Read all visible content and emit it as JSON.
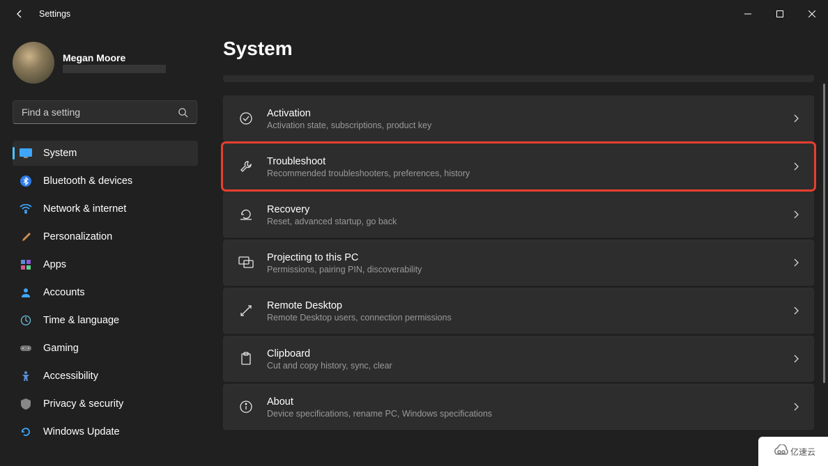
{
  "window": {
    "title": "Settings"
  },
  "user": {
    "name": "Megan Moore"
  },
  "search": {
    "placeholder": "Find a setting"
  },
  "sidebar": {
    "items": [
      {
        "label": "System",
        "icon": "💻",
        "active": true
      },
      {
        "label": "Bluetooth & devices",
        "icon": "bt"
      },
      {
        "label": "Network & internet",
        "icon": "wifi"
      },
      {
        "label": "Personalization",
        "icon": "brush"
      },
      {
        "label": "Apps",
        "icon": "apps"
      },
      {
        "label": "Accounts",
        "icon": "person"
      },
      {
        "label": "Time & language",
        "icon": "clock"
      },
      {
        "label": "Gaming",
        "icon": "gamepad"
      },
      {
        "label": "Accessibility",
        "icon": "a11y"
      },
      {
        "label": "Privacy & security",
        "icon": "shield"
      },
      {
        "label": "Windows Update",
        "icon": "update"
      }
    ]
  },
  "page": {
    "title": "System"
  },
  "cards": [
    {
      "title": "Activation",
      "sub": "Activation state, subscriptions, product key",
      "icon": "check",
      "hl": false
    },
    {
      "title": "Troubleshoot",
      "sub": "Recommended troubleshooters, preferences, history",
      "icon": "wrench",
      "hl": true
    },
    {
      "title": "Recovery",
      "sub": "Reset, advanced startup, go back",
      "icon": "recovery",
      "hl": false
    },
    {
      "title": "Projecting to this PC",
      "sub": "Permissions, pairing PIN, discoverability",
      "icon": "project",
      "hl": false
    },
    {
      "title": "Remote Desktop",
      "sub": "Remote Desktop users, connection permissions",
      "icon": "remote",
      "hl": false
    },
    {
      "title": "Clipboard",
      "sub": "Cut and copy history, sync, clear",
      "icon": "clipboard",
      "hl": false
    },
    {
      "title": "About",
      "sub": "Device specifications, rename PC, Windows specifications",
      "icon": "info",
      "hl": false
    }
  ],
  "watermark": {
    "text": "亿速云"
  }
}
